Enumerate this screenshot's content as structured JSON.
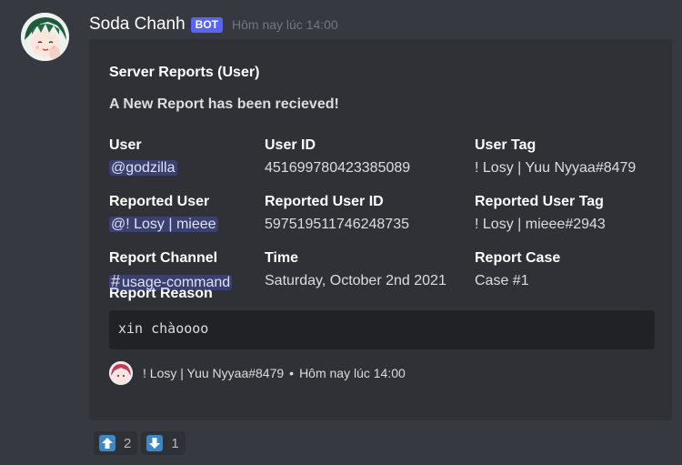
{
  "message": {
    "author": "Soda Chanh",
    "bot_tag": "BOT",
    "timestamp": "Hôm nay lúc 14:00"
  },
  "embed": {
    "title": "Server Reports (User)",
    "description": "A New Report has been recieved!",
    "fields": {
      "user": {
        "name": "User",
        "value": "@godzilla"
      },
      "user_id": {
        "name": "User ID",
        "value": "451699780423385089"
      },
      "user_tag": {
        "name": "User Tag",
        "value": "! Losy | Yuu Nyyaa#8479"
      },
      "reported_user": {
        "name": "Reported User",
        "value": "@! Losy | mieee"
      },
      "reported_user_id": {
        "name": "Reported User ID",
        "value": "597519511746248735"
      },
      "reported_user_tag": {
        "name": "Reported User Tag",
        "value": "! Losy | mieee#2943"
      },
      "report_channel": {
        "name": "Report Channel",
        "value": "usage-command"
      },
      "time": {
        "name": "Time",
        "value": "Saturday, October 2nd 2021"
      },
      "report_case": {
        "name": "Report Case",
        "value": "Case #1"
      }
    },
    "reason": {
      "name": "Report Reason",
      "value": "xin chàoooo"
    },
    "footer": {
      "text": "! Losy | Yuu Nyyaa#8479",
      "separator": "•",
      "timestamp": "Hôm nay lúc 14:00"
    }
  },
  "reactions": [
    {
      "emoji": "up-arrow-icon",
      "count": "2"
    },
    {
      "emoji": "down-arrow-icon",
      "count": "1"
    }
  ],
  "colors": {
    "background": "#36393f",
    "embed_background": "#2f3136",
    "code_background": "#202225",
    "mention": "#5865f2",
    "reaction_emoji": "#3b88c3"
  }
}
